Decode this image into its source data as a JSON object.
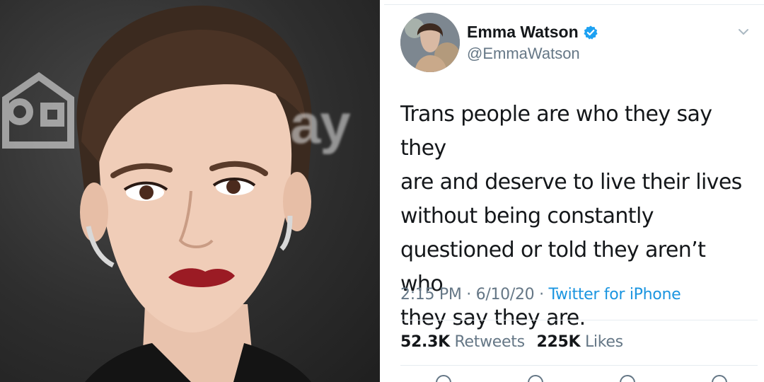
{
  "photo": {
    "backdrop_text": "ay",
    "backdrop_logo_icon": "house-icon"
  },
  "tweet": {
    "display_name": "Emma Watson",
    "handle": "@EmmaWatson",
    "verified_icon": "verified-badge-icon",
    "menu_icon": "chevron-down-icon",
    "text_lines": [
      "Trans people are who they say they",
      "are and deserve to live their lives",
      "without being constantly",
      "questioned or told they aren’t who",
      "they say they are."
    ],
    "time": "2:15 PM",
    "date": "6/10/20",
    "separator": "·",
    "source": "Twitter for iPhone",
    "retweets_count": "52.3K",
    "retweets_label": "Retweets",
    "likes_count": "225K",
    "likes_label": "Likes",
    "action_icons": [
      "reply-icon",
      "retweet-icon",
      "like-icon",
      "share-icon"
    ]
  },
  "colors": {
    "text": "#14171a",
    "muted": "#657786",
    "link": "#1b95e0",
    "verified": "#1da1f2",
    "divider": "#e6ecf0"
  }
}
